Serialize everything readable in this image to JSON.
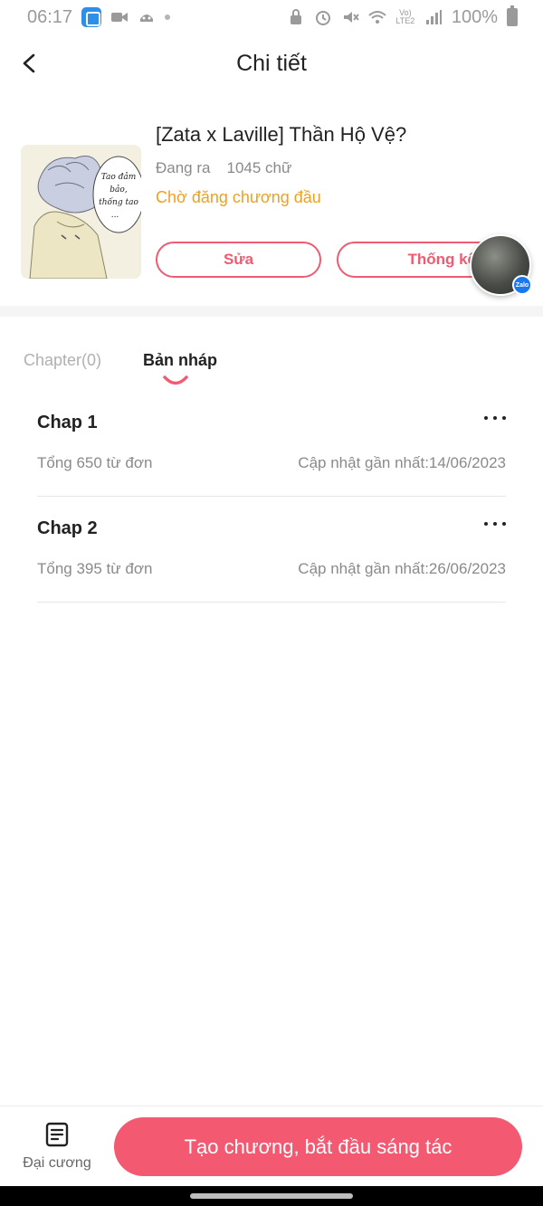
{
  "status_bar": {
    "time": "06:17",
    "battery": "100%",
    "network": "Vo) LTE2"
  },
  "header": {
    "title": "Chi tiết"
  },
  "book": {
    "title": "[Zata x Laville] Thần Hộ Vệ?",
    "state": "Đang ra",
    "word_count": "1045 chữ",
    "status": "Chờ đăng chương đầu",
    "edit_label": "Sửa",
    "stats_label": "Thống kê",
    "cover_text": [
      "Tao đảm",
      "bảo,",
      "thống tao",
      "..."
    ]
  },
  "floating": {
    "badge": "Zalo"
  },
  "tabs": {
    "chapter": "Chapter(0)",
    "draft": "Bản nháp"
  },
  "chapters": [
    {
      "name": "Chap 1",
      "count": "Tổng 650 từ đơn",
      "updated": "Cập nhật gần nhất:14/06/2023"
    },
    {
      "name": "Chap 2",
      "count": "Tổng 395 từ đơn",
      "updated": "Cập nhật gần nhất:26/06/2023"
    }
  ],
  "bottom": {
    "outline_label": "Đại cương",
    "create_label": "Tạo chương, bắt đầu sáng tác"
  },
  "colors": {
    "accent": "#f35a72",
    "status_orange": "#f0a020"
  }
}
